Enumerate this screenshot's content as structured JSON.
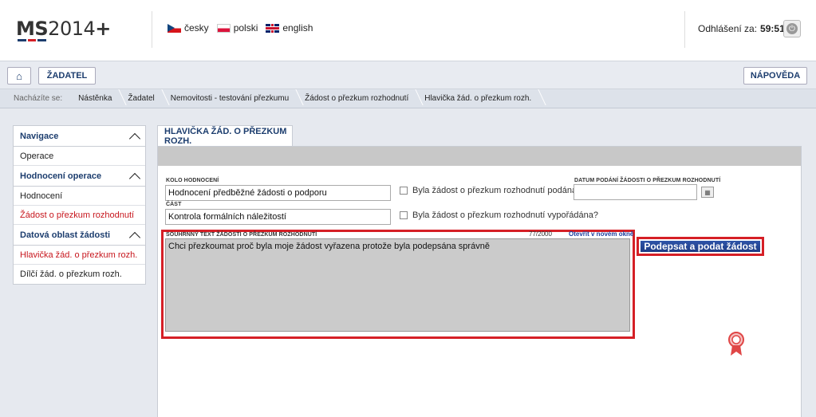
{
  "header": {
    "logo_ms": "MS",
    "logo_year": "2014",
    "logo_plus": "+",
    "languages": [
      {
        "label": "česky",
        "icon": "czech-flag-icon"
      },
      {
        "label": "polski",
        "icon": "polish-flag-icon"
      },
      {
        "label": "english",
        "icon": "uk-flag-icon"
      }
    ],
    "logout_label": "Odhlášení za:",
    "logout_timer": "59:51"
  },
  "navbar": {
    "home_icon": "home-icon",
    "zadatel_label": "ŽADATEL",
    "help_label": "NÁPOVĚDA"
  },
  "breadcrumb": {
    "prefix": "Nacházíte se:",
    "items": [
      "Nástěnka",
      "Žadatel",
      "Nemovitosti - testování přezkumu",
      "Žádost o přezkum rozhodnutí",
      "Hlavička žád. o přezkum rozh."
    ]
  },
  "sidebar": {
    "sections": [
      {
        "title": "Navigace",
        "items": [
          "Operace"
        ]
      },
      {
        "title": "Hodnocení operace",
        "items": [
          "Hodnocení",
          "Žádost o přezkum rozhodnutí"
        ]
      },
      {
        "title": "Datová oblast žádosti",
        "items": [
          "Hlavička žád. o přezkum rozh.",
          "Dílčí žád. o přezkum rozh."
        ]
      }
    ]
  },
  "content": {
    "tab_title": "HLAVIČKA ŽÁD. O PŘEZKUM ROZH.",
    "kolo_label": "KOLO HODNOCENÍ",
    "kolo_value": "Hodnocení předběžné žádosti o podporu",
    "cast_label": "ČÁST",
    "cast_value": "Kontrola formálních náležitostí",
    "chk_podana": "Byla žádost o přezkum rozhodnutí podána?",
    "chk_vyporadana": "Byla žádost o přezkum rozhodnutí vypořádána?",
    "datum_label": "DATUM PODÁNÍ ŽÁDOSTI O PŘEZKUM ROZHODNUTÍ",
    "datum_value": "",
    "souhrnny_label": "SOUHRNNÝ TEXT ŽÁDOSTI O PŘEZKUM ROZHODNUTÍ",
    "souhrnny_counter": "77/2000",
    "open_window": "Otevřít v novém okně",
    "souhrnny_text": "Chci přezkoumat proč byla moje žádost vyřazena protože byla podepsána správně",
    "sign_button": "Podepsat a podat žádost"
  },
  "colors": {
    "brand_blue": "#1c3d6e",
    "highlight_red": "#d51f26",
    "active_red": "#c7161d"
  }
}
